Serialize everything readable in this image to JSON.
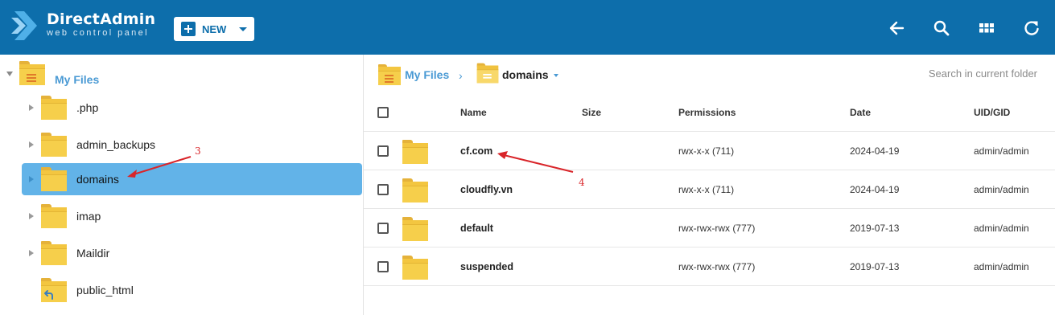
{
  "header": {
    "brand_name": "DirectAdmin",
    "brand_sub": "web control panel",
    "new_label": "NEW",
    "icons": [
      "back-arrow-icon",
      "search-icon",
      "grid-view-icon",
      "refresh-icon"
    ],
    "colors": {
      "bar": "#0d6eab",
      "accent": "#4a9ad4",
      "selected": "#62b3e8"
    }
  },
  "tree": {
    "root_label": "My Files",
    "items": [
      {
        "label": ".php"
      },
      {
        "label": "admin_backups"
      },
      {
        "label": "domains",
        "selected": true
      },
      {
        "label": "imap"
      },
      {
        "label": "Maildir"
      },
      {
        "label": "public_html"
      }
    ]
  },
  "breadcrumb": {
    "root": "My Files",
    "current": "domains"
  },
  "search": {
    "placeholder": "Search in current folder"
  },
  "table": {
    "columns": {
      "name": "Name",
      "size": "Size",
      "permissions": "Permissions",
      "date": "Date",
      "uid": "UID/GID"
    },
    "rows": [
      {
        "name": "cf.com",
        "size": "",
        "permissions": "rwx-x-x (711)",
        "date": "2024-04-19",
        "uid": "admin/admin"
      },
      {
        "name": "cloudfly.vn",
        "size": "",
        "permissions": "rwx-x-x (711)",
        "date": "2024-04-19",
        "uid": "admin/admin"
      },
      {
        "name": "default",
        "size": "",
        "permissions": "rwx-rwx-rwx (777)",
        "date": "2019-07-13",
        "uid": "admin/admin"
      },
      {
        "name": "suspended",
        "size": "",
        "permissions": "rwx-rwx-rwx (777)",
        "date": "2019-07-13",
        "uid": "admin/admin"
      }
    ]
  },
  "annotations": {
    "n3": "3",
    "n4": "4"
  }
}
